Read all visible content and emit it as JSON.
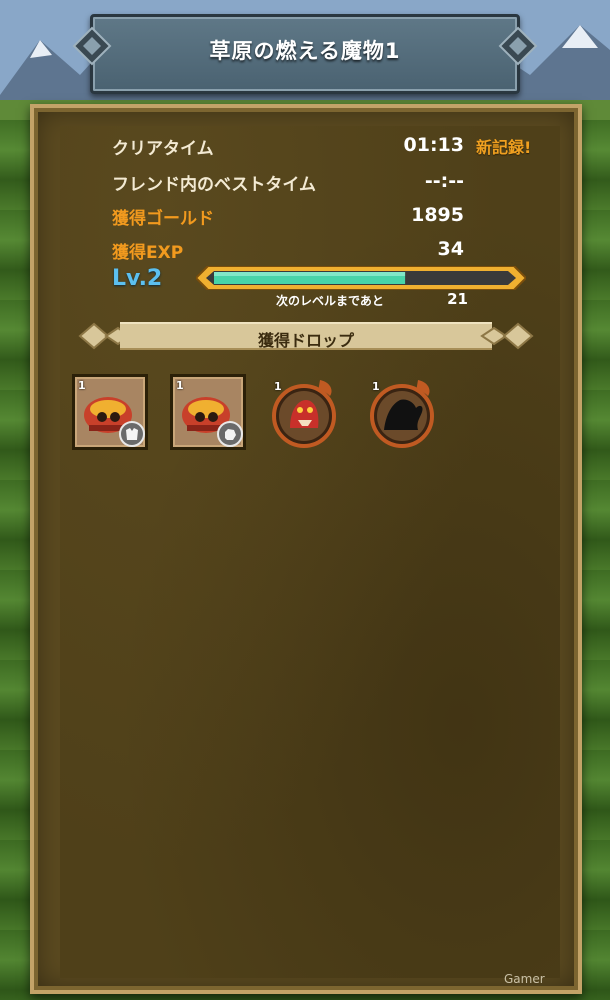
{
  "title": "草原の燃える魔物1",
  "stats": {
    "clear_time_label": "クリアタイム",
    "clear_time_value": "01:13",
    "new_record": "新記録!",
    "friend_best_label": "フレンド内のベストタイム",
    "friend_best_value": "--:--",
    "gold_label": "獲得ゴールド",
    "gold_value": "1895",
    "exp_label": "獲得EXP",
    "exp_value": "34"
  },
  "level": {
    "label": "Lv.2",
    "progress": 0.65,
    "next_label": "次のレベルまであと",
    "next_value": "21"
  },
  "drops": {
    "header": "獲得ドロップ",
    "items": [
      {
        "rarity": "1",
        "icon": "red-armor-helmet-icon",
        "badge": "chest-armor-badge-icon"
      },
      {
        "rarity": "1",
        "icon": "red-armor-helmet-icon",
        "badge": "gauntlet-badge-icon"
      },
      {
        "rarity": "1",
        "icon": "red-dragon-monster-icon"
      },
      {
        "rarity": "1",
        "icon": "silhouette-monster-icon"
      }
    ]
  },
  "watermark": "Gamer",
  "colors": {
    "orange_label": "#f29a1e",
    "level_blue": "#5cc0f0",
    "exp_fill": "#48d4a8",
    "panel_brown": "#4f4019"
  }
}
